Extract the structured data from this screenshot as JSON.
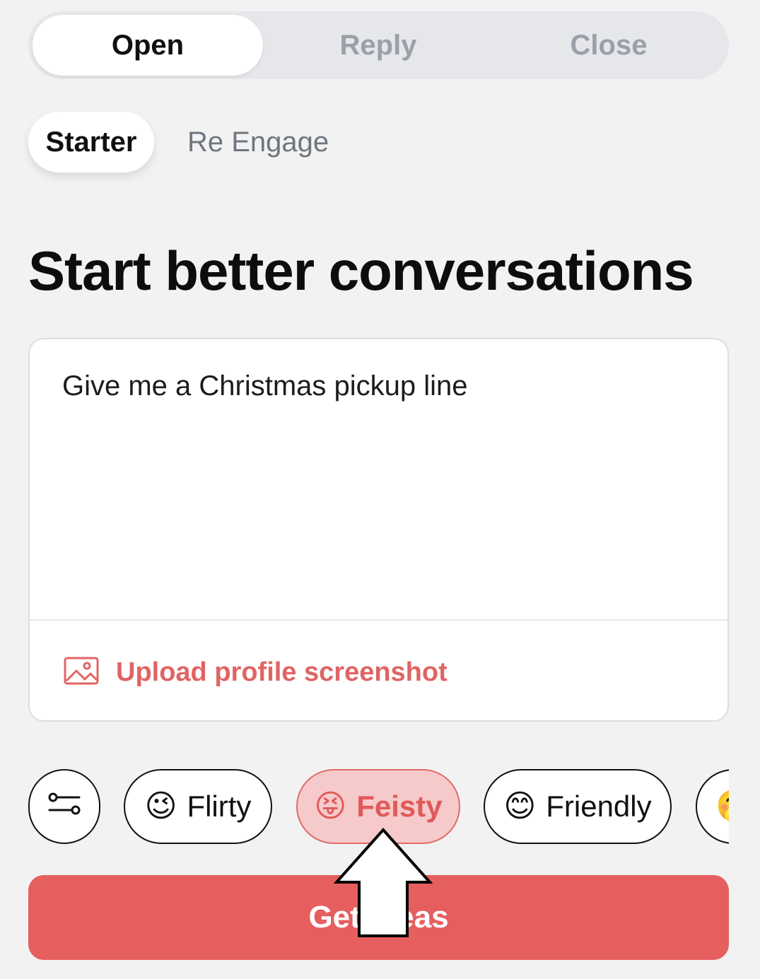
{
  "segmented_tabs": [
    {
      "label": "Open",
      "active": true
    },
    {
      "label": "Reply",
      "active": false
    },
    {
      "label": "Close",
      "active": false
    }
  ],
  "sub_tabs": [
    {
      "label": "Starter",
      "active": true
    },
    {
      "label": "Re Engage",
      "active": false
    }
  ],
  "heading": "Start better conversations",
  "prompt": {
    "value": "Give me a Christmas pickup line"
  },
  "upload": {
    "label": "Upload profile screenshot",
    "icon": "image-icon"
  },
  "tone_chips": [
    {
      "label": "Flirty",
      "emoji": "😉",
      "selected": false
    },
    {
      "label": "Feisty",
      "emoji": "😝",
      "selected": true
    },
    {
      "label": "Friendly",
      "emoji": "😊",
      "selected": false
    },
    {
      "label": "",
      "emoji": "🤭",
      "selected": false
    }
  ],
  "cta": {
    "label": "Get Ideas"
  },
  "colors": {
    "accent": "#e65f5f",
    "selected_chip_bg": "#f6caca",
    "background": "#f2f2f3"
  }
}
